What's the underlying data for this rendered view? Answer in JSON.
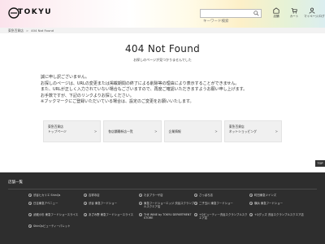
{
  "header": {
    "logo_text": "TOKYU",
    "search_placeholder": "キーワード検索",
    "icons": [
      {
        "name": "store-icon",
        "label": "店舗"
      },
      {
        "name": "cart-icon",
        "label": "カート"
      },
      {
        "name": "mypage-icon",
        "label": "マイページ/ログイン"
      }
    ]
  },
  "breadcrumb": {
    "home": "東急百貨店",
    "separator": ">",
    "current": "404 Not Found"
  },
  "main": {
    "title": "404 Not Found",
    "subtitle": "お探しのページが見つかりませんでした",
    "messages": [
      "誠に申し訳ございません。",
      "お探しのページは、URLの変更または掲載期間の終了による削除等の理由により表示することができません。",
      "また、URLが正しく入力されていない場合もございますので、再度ご確認いただきますようお願い申し上げます。",
      "お手数ですが、下記のリンクよりお探しください。",
      "※ブックマークにご登録いただいている場合は、設定のご変更をお願いいたします。"
    ],
    "cards": [
      {
        "line1": "東急百貨店",
        "line2": "トップページ"
      },
      {
        "line1": "各店舗最新店一覧",
        "line2": ""
      },
      {
        "line1": "企業情報",
        "line2": ""
      },
      {
        "line1": "東急百貨店",
        "line2": "ネットショッピング"
      }
    ],
    "card_arrow": ">"
  },
  "top_button": "TOP",
  "footer": {
    "title": "店舗一覧",
    "stores": [
      [
        "渋谷ヒカリエ ShinQs",
        "吉祥寺店",
        "たまプラーザ店",
        "さっぽろ店",
        "町田東急ツインズ"
      ],
      [
        "日吉東急アベニュー",
        "渋谷 東急フードショー",
        "東急フードショーエッジ 渋谷スクランブルスクエア店",
        "二子玉川 東急フードショー",
        "横浜 東急フードショー"
      ],
      [
        "武蔵小杉 東急フードショースライス",
        "あざみ野 東急フードショースライス",
        "THE WINE by TOKYU DEPARTMENT STORE",
        "+Qビューティー渋谷スクランブルスクエア店",
        "+Qグッズ 渋谷スクランブルスクエア店"
      ],
      [
        "ShinQsビューティーパレット"
      ]
    ]
  },
  "colors": {
    "footer_bg": "#2e2e2e",
    "breadcrumb_bg": "#f2f2f2",
    "card_bg": "#f0f0f0"
  }
}
